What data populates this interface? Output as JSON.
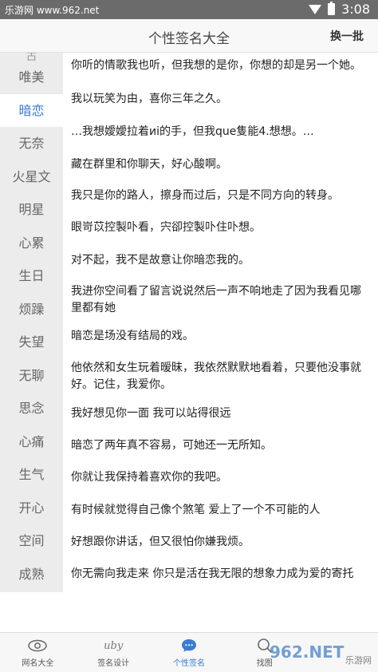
{
  "status_bar": {
    "left_text": "乐游网 www.962.net",
    "time": "3:08"
  },
  "header": {
    "title": "个性签名大全",
    "switch_label": "换一批"
  },
  "sidebar": {
    "partial_top": "古",
    "categories": [
      "唯美",
      "暗恋",
      "无奈",
      "火星文",
      "明星",
      "心累",
      "生日",
      "烦躁",
      "失望",
      "无聊",
      "思念",
      "心痛",
      "生气",
      "开心",
      "空间",
      "成熟"
    ],
    "active": "暗恋"
  },
  "signatures": [
    "你听的情歌我也听，但我想的是你，你想的却是另一个她。",
    "我以玩笑为由，喜你三年之久。",
    "…我想嬡嬡拉着иi的手，但我que隻能4.想想。…",
    "藏在群里和你聊天，好心酸啊。",
    "我只是你的路人，擦身而过后，只是不同方向的转身。",
    "眼岢苡控製卟看，宍卻控製卟住卟想。",
    "对不起，我不是故意让你暗恋我的。",
    "我进你空间看了留言说说然后一声不响地走了因为我看见哪里都有她",
    "暗恋是场没有结局的戏。",
    "他依然和女生玩着暧昧，我依然默默地看着，只要他没事就好。记住，我爱你。",
    "我好想见你一面 我可以站得很远",
    "暗恋了两年真不容易，可她还一无所知。",
    "你就让我保持着喜欢你的我吧。",
    "有时候就觉得自己像个煞笔 爱上了一个不可能的人",
    "好想跟你讲话，但又很怕你嫌我烦。",
    "你无需向我走来 你只是活在我无限的想象力成为爱的寄托"
  ],
  "tabs": [
    {
      "label": "网名大全",
      "icon": "eye-icon"
    },
    {
      "label": "签名设计",
      "icon": "signature-icon",
      "icon_text": "uby"
    },
    {
      "label": "个性签名",
      "icon": "chat-bubble-icon"
    },
    {
      "label": "找图",
      "icon": "search-icon"
    }
  ],
  "active_tab": "个性签名",
  "watermark": {
    "main": "962.NET",
    "sub": "乐游网"
  },
  "colors": {
    "accent": "#3a7bd5",
    "status_bar": "#6b6b6b",
    "sidebar_bg": "#ececec"
  }
}
